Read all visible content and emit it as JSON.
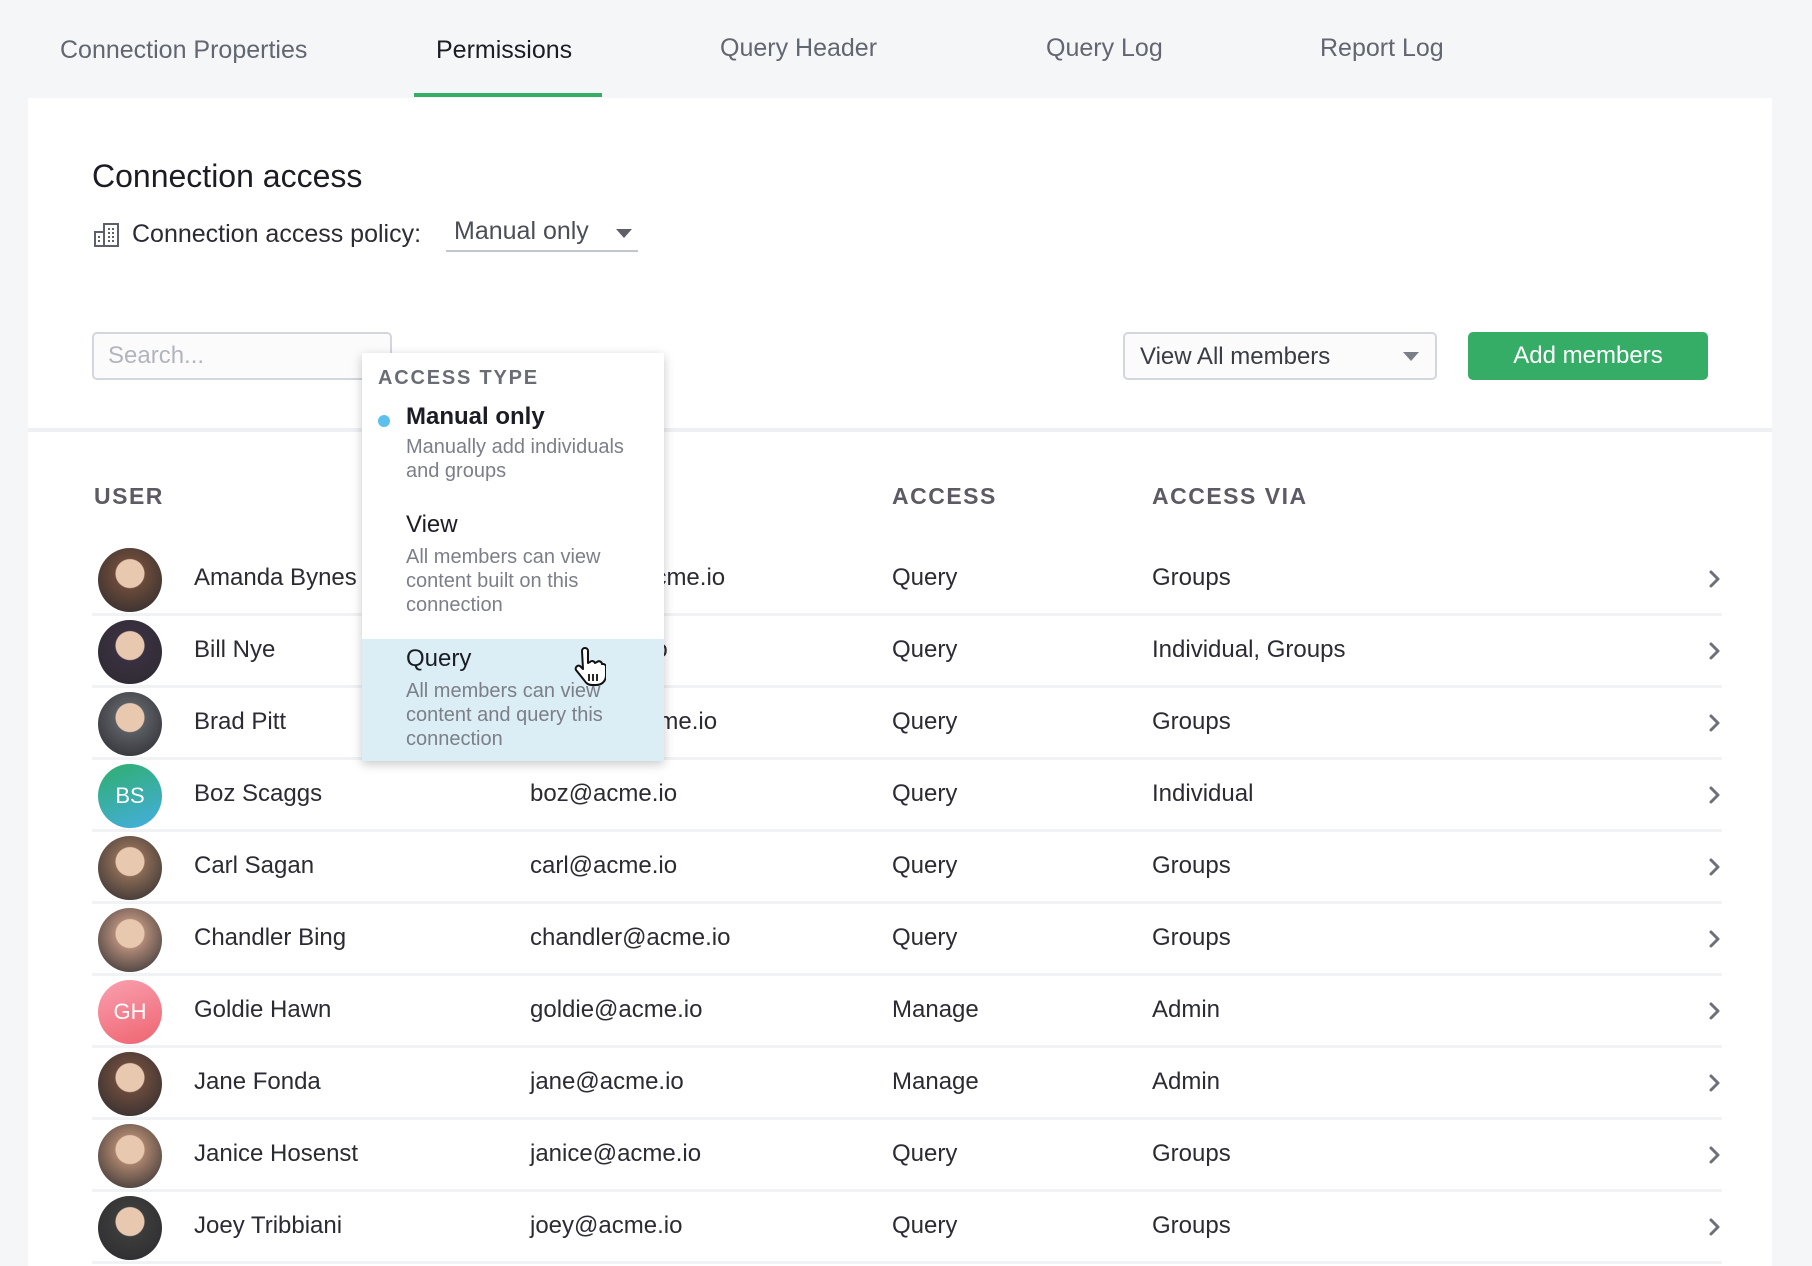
{
  "tabs": [
    {
      "label": "Connection Properties",
      "active": false
    },
    {
      "label": "Permissions",
      "active": true
    },
    {
      "label": "Query Header",
      "active": false
    },
    {
      "label": "Query Log",
      "active": false
    },
    {
      "label": "Report Log",
      "active": false
    }
  ],
  "colors": {
    "accent_green": "#36ad66",
    "selected_dot": "#5bc0eb",
    "hover_row": "#dbedf5"
  },
  "section": {
    "title": "Connection access",
    "policy_label": "Connection access policy:",
    "policy_value": "Manual only",
    "policy_icon": "building-icon"
  },
  "dropdown": {
    "heading": "ACCESS TYPE",
    "options": [
      {
        "title": "Manual only",
        "description": "Manually add individuals and groups",
        "selected": true,
        "hovered": false
      },
      {
        "title": "View",
        "description": "All members can view content built on this connection",
        "selected": false,
        "hovered": false
      },
      {
        "title": "Query",
        "description": "All members can view content and query this connection",
        "selected": false,
        "hovered": true
      }
    ]
  },
  "toolbar": {
    "search_placeholder": "Search...",
    "search_value": "",
    "members_filter": "View All members",
    "add_button": "Add members"
  },
  "table": {
    "headers": {
      "user": "USER",
      "access": "ACCESS",
      "access_via": "ACCESS VIA"
    },
    "rows": [
      {
        "name": "Amanda Bynes",
        "email": "amanda@acme.io",
        "access": "Query",
        "via": "Groups",
        "avatar": "photo",
        "initials": "",
        "color": "#6b4a3a"
      },
      {
        "name": "Bill Nye",
        "email": "bill@acme.io",
        "access": "Query",
        "via": "Individual, Groups",
        "avatar": "photo",
        "initials": "",
        "color": "#3a3040"
      },
      {
        "name": "Brad Pitt",
        "email": "bradley@acme.io",
        "access": "Query",
        "via": "Groups",
        "avatar": "photo",
        "initials": "",
        "color": "#5a5d62"
      },
      {
        "name": "Boz Scaggs",
        "email": "boz@acme.io",
        "access": "Query",
        "via": "Individual",
        "avatar": "initials",
        "initials": "BS",
        "color": "#2fa878"
      },
      {
        "name": "Carl Sagan",
        "email": "carl@acme.io",
        "access": "Query",
        "via": "Groups",
        "avatar": "photo",
        "initials": "",
        "color": "#8a6a55"
      },
      {
        "name": "Chandler Bing",
        "email": "chandler@acme.io",
        "access": "Query",
        "via": "Groups",
        "avatar": "photo",
        "initials": "",
        "color": "#b08a78"
      },
      {
        "name": "Goldie Hawn",
        "email": "goldie@acme.io",
        "access": "Manage",
        "via": "Admin",
        "avatar": "initials",
        "initials": "GH",
        "color": "#f06a78"
      },
      {
        "name": "Jane Fonda",
        "email": "jane@acme.io",
        "access": "Manage",
        "via": "Admin",
        "avatar": "photo",
        "initials": "",
        "color": "#6a4a3c"
      },
      {
        "name": "Janice Hosenst",
        "email": "janice@acme.io",
        "access": "Query",
        "via": "Groups",
        "avatar": "photo",
        "initials": "",
        "color": "#a8826c"
      },
      {
        "name": "Joey Tribbiani",
        "email": "joey@acme.io",
        "access": "Query",
        "via": "Groups",
        "avatar": "photo",
        "initials": "",
        "color": "#3c3c3c"
      }
    ]
  }
}
